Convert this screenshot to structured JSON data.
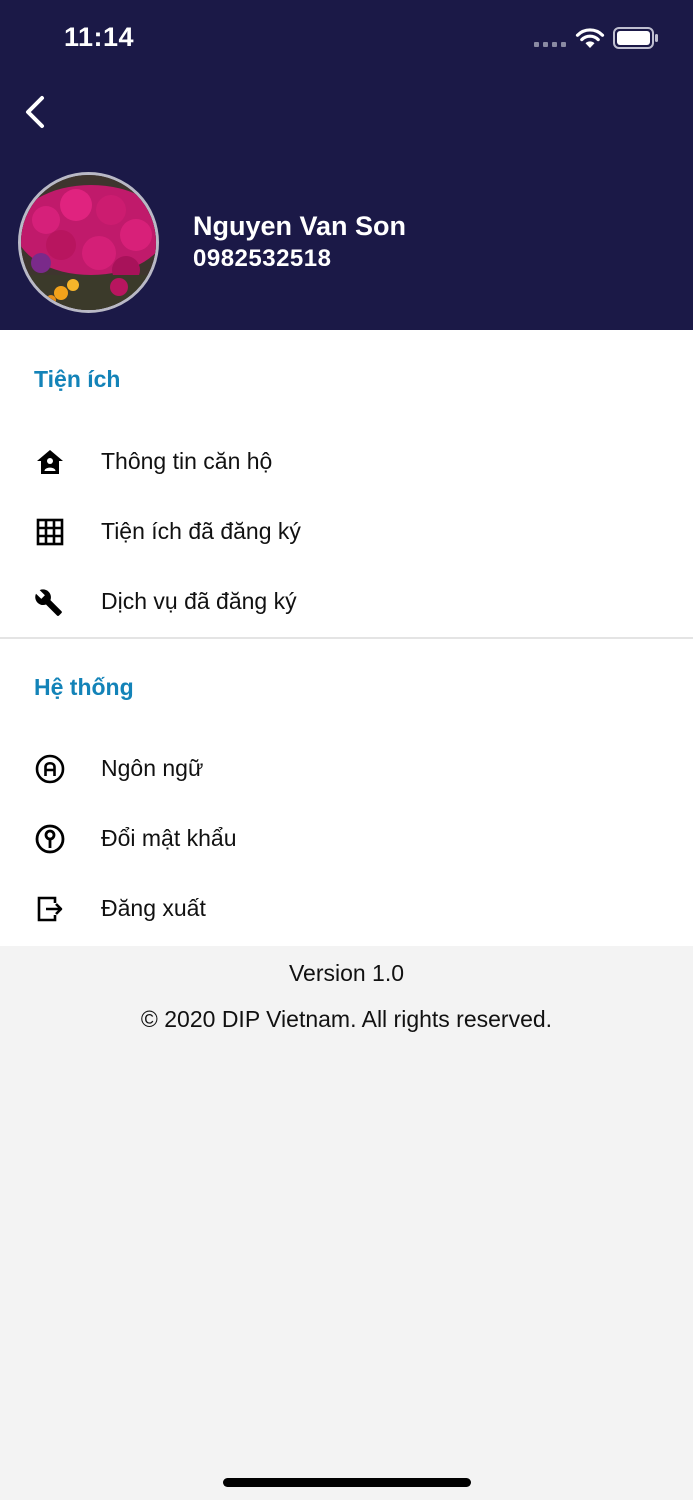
{
  "status_bar": {
    "time": "11:14",
    "icons": [
      "signal-icon",
      "wifi-icon",
      "battery-icon"
    ]
  },
  "header": {
    "back_icon": "chevron-left-icon",
    "avatar": "flower-photo-avatar",
    "user_name": "Nguyen Van Son",
    "user_phone": "0982532518"
  },
  "sections": {
    "utilities": {
      "title": "Tiện ích",
      "items": [
        {
          "label": "Thông tin căn hộ",
          "icon": "home-account-icon"
        },
        {
          "label": "Tiện ích đã đăng ký",
          "icon": "grid-icon"
        },
        {
          "label": "Dịch vụ đã đăng ký",
          "icon": "wrench-icon"
        }
      ]
    },
    "system": {
      "title": "Hệ thống",
      "items": [
        {
          "label": "Ngôn ngữ",
          "icon": "language-icon"
        },
        {
          "label": "Đổi mật khẩu",
          "icon": "key-icon"
        },
        {
          "label": "Đăng xuất",
          "icon": "logout-icon"
        }
      ]
    }
  },
  "footer": {
    "version": "Version 1.0",
    "copyright": "© 2020 DIP Vietnam. All rights reserved."
  },
  "colors": {
    "header_bg": "#1b1947",
    "section_title": "#1383b8",
    "page_bg": "#f3f3f3"
  }
}
